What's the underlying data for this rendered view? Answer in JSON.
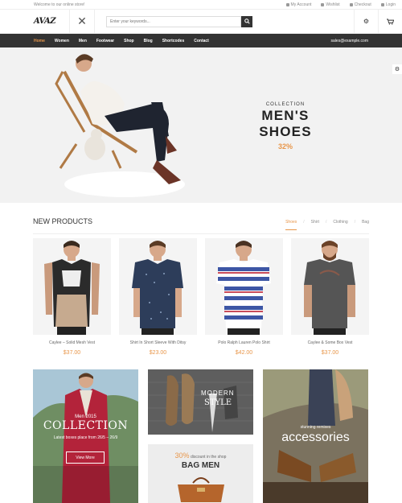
{
  "topbar": {
    "welcome": "Welcome to our online store!",
    "links": [
      "My Account",
      "Wishlist",
      "Checkout",
      "Login"
    ]
  },
  "header": {
    "logo": "AVAZ",
    "search_placeholder": "Enter your keywords..."
  },
  "nav": {
    "items": [
      "Home",
      "Women",
      "Men",
      "Footwear",
      "Shop",
      "Blog",
      "Shortcodes",
      "Contact"
    ],
    "email": "sales@example.com"
  },
  "hero": {
    "kicker": "COLLECTION",
    "title": "MEN'S SHOES",
    "percent": "32%"
  },
  "new_products": {
    "title": "NEW PRODUCTS",
    "tabs": [
      "Shoes",
      "Shirt",
      "Clothing",
      "Bag"
    ],
    "items": [
      {
        "name": "Caylee – Solid Mesh Vest",
        "price": "$37.00"
      },
      {
        "name": "Shirt In Short Sleeve With Ditsy",
        "price": "$23.00"
      },
      {
        "name": "Polo Ralph Lauren Polo Shirt",
        "price": "$42.00"
      },
      {
        "name": "Caylee & Some Box Vest",
        "price": "$37.00"
      }
    ]
  },
  "banners": {
    "collection": {
      "season": "Men 2015",
      "title": "COLLECTION",
      "subtitle": "Latest boxes place from 26/5 – 26/9",
      "button": "View More"
    },
    "style": {
      "line1": "MODERN",
      "line2": "STYLE"
    },
    "bag_men": {
      "percent": "30%",
      "discount_text": "discount in the shop",
      "title": "BAG MEN"
    },
    "accessories": {
      "pre": "stunning remixes",
      "title": "accessories"
    }
  },
  "colors": {
    "accent": "#e8964a",
    "nav_bg": "#333333",
    "hero_bg": "#f2f2f2"
  }
}
